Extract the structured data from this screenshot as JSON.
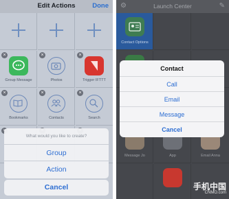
{
  "left": {
    "title": "Edit Actions",
    "done_label": "Done",
    "grid": [
      {
        "label": "",
        "type": "plus"
      },
      {
        "label": "",
        "type": "plus"
      },
      {
        "label": "",
        "type": "plus"
      },
      {
        "label": "Group Message",
        "type": "app",
        "icon": "message-bubble-icon",
        "color": "#3cb85c"
      },
      {
        "label": "Photos",
        "type": "outline",
        "icon": "camera-icon"
      },
      {
        "label": "Trigger IFTTT",
        "type": "app",
        "icon": "ifttt-icon",
        "color": "#d8362f"
      },
      {
        "label": "Bookmarks",
        "type": "outline",
        "icon": "book-icon"
      },
      {
        "label": "Contacts",
        "type": "outline",
        "icon": "contacts-icon"
      },
      {
        "label": "Search",
        "type": "outline",
        "icon": "search-icon"
      }
    ],
    "sheet": {
      "title": "What would you like to create?",
      "options": [
        "Group",
        "Action"
      ],
      "cancel": "Cancel"
    }
  },
  "right": {
    "title": "Launch Center",
    "selected_label": "Contact Options",
    "bottom_labels": [
      "Message Jo",
      "App",
      "Email Anna"
    ],
    "alert": {
      "title": "Contact",
      "options": [
        "Call",
        "Email",
        "Message"
      ],
      "cancel": "Cancel"
    }
  },
  "watermark": {
    "text": "手机中国",
    "sub": "CNMO.com"
  },
  "colors": {
    "accent": "#2c6dd2",
    "selected_tile": "#2a5a9c"
  }
}
